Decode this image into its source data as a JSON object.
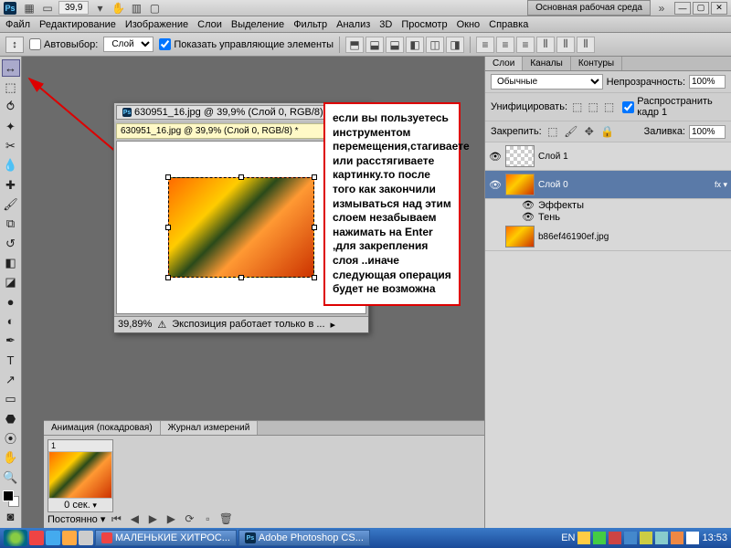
{
  "titlebar": {
    "zoom": "39,9",
    "workspace": "Основная рабочая среда",
    "chevrons": "»"
  },
  "menu": [
    "Файл",
    "Редактирование",
    "Изображение",
    "Слои",
    "Выделение",
    "Фильтр",
    "Анализ",
    "3D",
    "Просмотр",
    "Окно",
    "Справка"
  ],
  "options": {
    "autoselect_label": "Автовыбор:",
    "autoselect_value": "Слой",
    "show_controls": "Показать управляющие элементы"
  },
  "document": {
    "tab": "630951_16.jpg @ 39,9% (Слой 0, RGB/8) *",
    "title_tip": "630951_16.jpg @ 39,9% (Слой 0, RGB/8) *",
    "status_zoom": "39,89%",
    "status_text": "Экспозиция работает только в ..."
  },
  "callout": "если вы пользуетесь инструментом перемещения,стагиваете или расстягиваете картинку.то после того как закончили измываться над этим слоем незабываем нажимать на Enter ,для закрепления слоя ..иначе следующая операция будет не возможна",
  "animation": {
    "tab1": "Анимация (покадровая)",
    "tab2": "Журнал измерений",
    "frame_num": "1",
    "frame_time": "0 сек.",
    "loop": "Постоянно"
  },
  "layers_panel": {
    "tabs": [
      "Слои",
      "Каналы",
      "Контуры"
    ],
    "blend": "Обычные",
    "opacity_label": "Непрозрачность:",
    "opacity": "100%",
    "unify_label": "Унифицировать:",
    "propagate": "Распространить кадр 1",
    "lock_label": "Закрепить:",
    "fill_label": "Заливка:",
    "fill": "100%",
    "layers": [
      {
        "name": "Слой 1",
        "type": "blank"
      },
      {
        "name": "Слой 0",
        "type": "img",
        "selected": true
      },
      {
        "name": "b86ef46190ef.jpg",
        "type": "img"
      }
    ],
    "fx": "Эффекты",
    "shadow": "Тень"
  },
  "taskbar": {
    "items": [
      "МАЛЕНЬКИЕ ХИТРОС...",
      "Adobe Photoshop CS..."
    ],
    "lang": "EN",
    "clock": "13:53"
  }
}
